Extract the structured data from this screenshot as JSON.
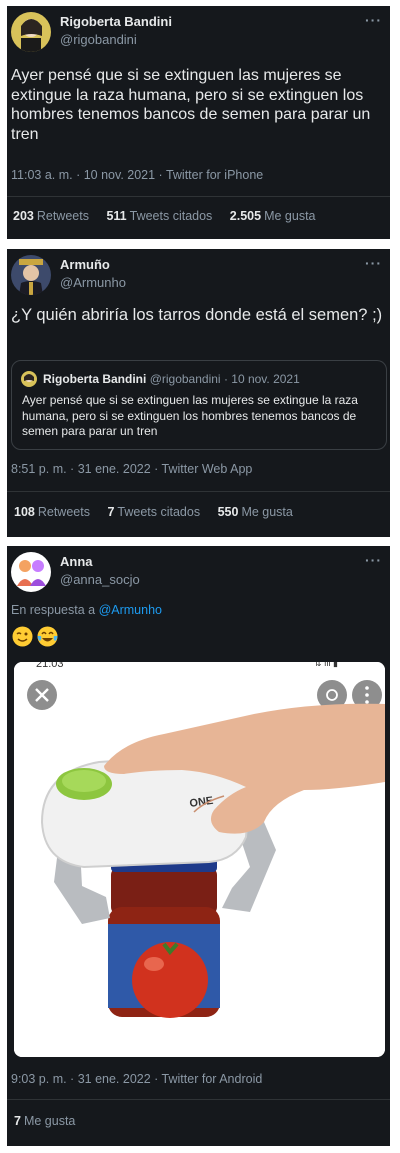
{
  "tweet1": {
    "name": "Rigoberta Bandini",
    "handle": "@rigobandini",
    "more": "···",
    "text": "Ayer pensé que si se extinguen las mujeres se extingue la raza humana, pero si se extinguen los hombres tenemos bancos de semen para parar un tren",
    "meta": "11:03 a. m. · 10 nov. 2021 · Twitter for iPhone",
    "retweets_count": "203",
    "retweets_label": "Retweets",
    "quotes_count": "511",
    "quotes_label": "Tweets citados",
    "likes_count": "2.505",
    "likes_label": "Me gusta"
  },
  "tweet2": {
    "name": "Armuño",
    "handle": "@Armunho",
    "more": "···",
    "text": "¿Y quién abriría los tarros donde está el semen? ;)",
    "quoted": {
      "name": "Rigoberta Bandini",
      "handle": "@rigobandini",
      "date": "· 10 nov. 2021",
      "text": "Ayer pensé que si se extinguen las mujeres se extingue la raza humana, pero si se extinguen los hombres tenemos bancos de semen para parar un tren"
    },
    "meta": "8:51 p. m. · 31 ene. 2022 · Twitter Web App",
    "retweets_count": "108",
    "retweets_label": "Retweets",
    "quotes_count": "7",
    "quotes_label": "Tweets citados",
    "likes_count": "550",
    "likes_label": "Me gusta"
  },
  "tweet3": {
    "name": "Anna",
    "handle": "@anna_socjo",
    "more": "···",
    "reply_prefix": "En respuesta a",
    "reply_to": "@Armunho",
    "emojis": [
      "winking-face",
      "tears-of-joy-face"
    ],
    "image_status_time": "21:03",
    "image_subject": "electric-jar-opener",
    "meta": "9:03 p. m. · 31 ene. 2022 · Twitter for Android",
    "likes_count": "7",
    "likes_label": "Me gusta"
  },
  "colors": {
    "card_bg": "#15181c",
    "text": "#e7e9ea",
    "muted": "#8b98a5",
    "link": "#1d9bf0",
    "border": "#2f3336"
  }
}
